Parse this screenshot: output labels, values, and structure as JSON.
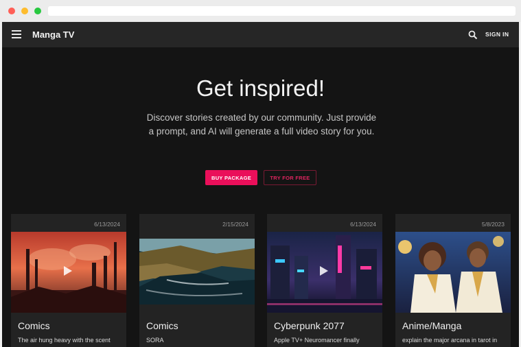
{
  "header": {
    "brand": "Manga TV",
    "signin_label": "SIGN IN"
  },
  "hero": {
    "title": "Get inspired!",
    "subtitle": "Discover stories created by our community. Just provide a prompt, and AI will generate a full video story for you.",
    "buy_label": "BUY PACKAGE",
    "try_label": "TRY FOR FREE"
  },
  "icons": {
    "menu": "menu-icon",
    "search": "search-icon",
    "play": "play-icon"
  },
  "colors": {
    "accent": "#ea0f5a",
    "background": "#141414",
    "appbar": "#262626",
    "card": "#232323"
  },
  "cards": [
    {
      "date": "6/13/2024",
      "title": "Comics",
      "desc": "The air hung heavy with the scent"
    },
    {
      "date": "2/15/2024",
      "title": "Comics",
      "desc": "SORA"
    },
    {
      "date": "6/13/2024",
      "title": "Cyberpunk 2077",
      "desc": "Apple TV+ Neuromancer finally"
    },
    {
      "date": "5/8/2023",
      "title": "Anime/Manga",
      "desc": "explain the major arcana in tarot in"
    }
  ]
}
